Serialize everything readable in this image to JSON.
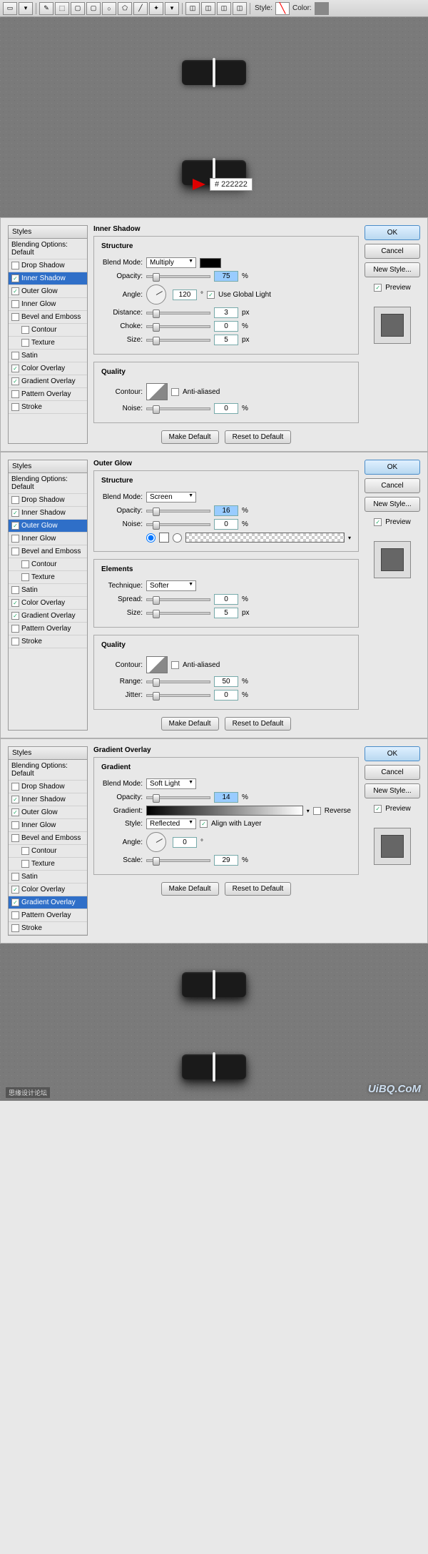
{
  "toolbar": {
    "style_label": "Style:",
    "color_label": "Color:"
  },
  "hex_value": "# 222222",
  "common": {
    "styles_header": "Styles",
    "blending_options": "Blending Options: Default",
    "ok": "OK",
    "cancel": "Cancel",
    "new_style": "New Style...",
    "preview": "Preview",
    "make_default": "Make Default",
    "reset_default": "Reset to Default",
    "blend_mode": "Blend Mode:",
    "opacity": "Opacity:",
    "angle": "Angle:",
    "distance": "Distance:",
    "choke": "Choke:",
    "size": "Size:",
    "noise": "Noise:",
    "contour": "Contour:",
    "anti_aliased": "Anti-aliased",
    "range": "Range:",
    "jitter": "Jitter:",
    "technique": "Technique:",
    "spread": "Spread:",
    "gradient": "Gradient:",
    "style": "Style:",
    "scale": "Scale:",
    "reverse": "Reverse",
    "align_layer": "Align with Layer",
    "use_global": "Use Global Light",
    "deg": "°",
    "pct": "%",
    "px": "px"
  },
  "style_items": [
    "Drop Shadow",
    "Inner Shadow",
    "Outer Glow",
    "Inner Glow",
    "Bevel and Emboss",
    "Contour",
    "Texture",
    "Satin",
    "Color Overlay",
    "Gradient Overlay",
    "Pattern Overlay",
    "Stroke"
  ],
  "panel1": {
    "title": "Inner Shadow",
    "sub1": "Structure",
    "sub2": "Quality",
    "checked": [
      false,
      true,
      true,
      false,
      false,
      false,
      false,
      false,
      true,
      true,
      false,
      false
    ],
    "selected": "Inner Shadow",
    "blend_mode": "Multiply",
    "swatch": "#000000",
    "opacity": "75",
    "angle": "120",
    "use_global": true,
    "distance": "3",
    "choke": "0",
    "size": "5",
    "anti_aliased": false,
    "noise": "0"
  },
  "panel2": {
    "title": "Outer Glow",
    "sub1": "Structure",
    "sub2": "Elements",
    "sub3": "Quality",
    "checked": [
      false,
      true,
      true,
      false,
      false,
      false,
      false,
      false,
      true,
      true,
      false,
      false
    ],
    "selected": "Outer Glow",
    "blend_mode": "Screen",
    "opacity": "16",
    "noise": "0",
    "technique": "Softer",
    "spread": "0",
    "size": "5",
    "anti_aliased": false,
    "range": "50",
    "jitter": "0"
  },
  "panel3": {
    "title": "Gradient Overlay",
    "sub1": "Gradient",
    "checked": [
      false,
      true,
      true,
      false,
      false,
      false,
      false,
      false,
      true,
      true,
      false,
      false
    ],
    "selected": "Gradient Overlay",
    "blend_mode": "Soft Light",
    "opacity": "14",
    "reverse": false,
    "style": "Reflected",
    "align": true,
    "angle": "0",
    "scale": "29"
  },
  "watermark": "UiBQ.CoM",
  "wm_left": "思缘设计论坛"
}
